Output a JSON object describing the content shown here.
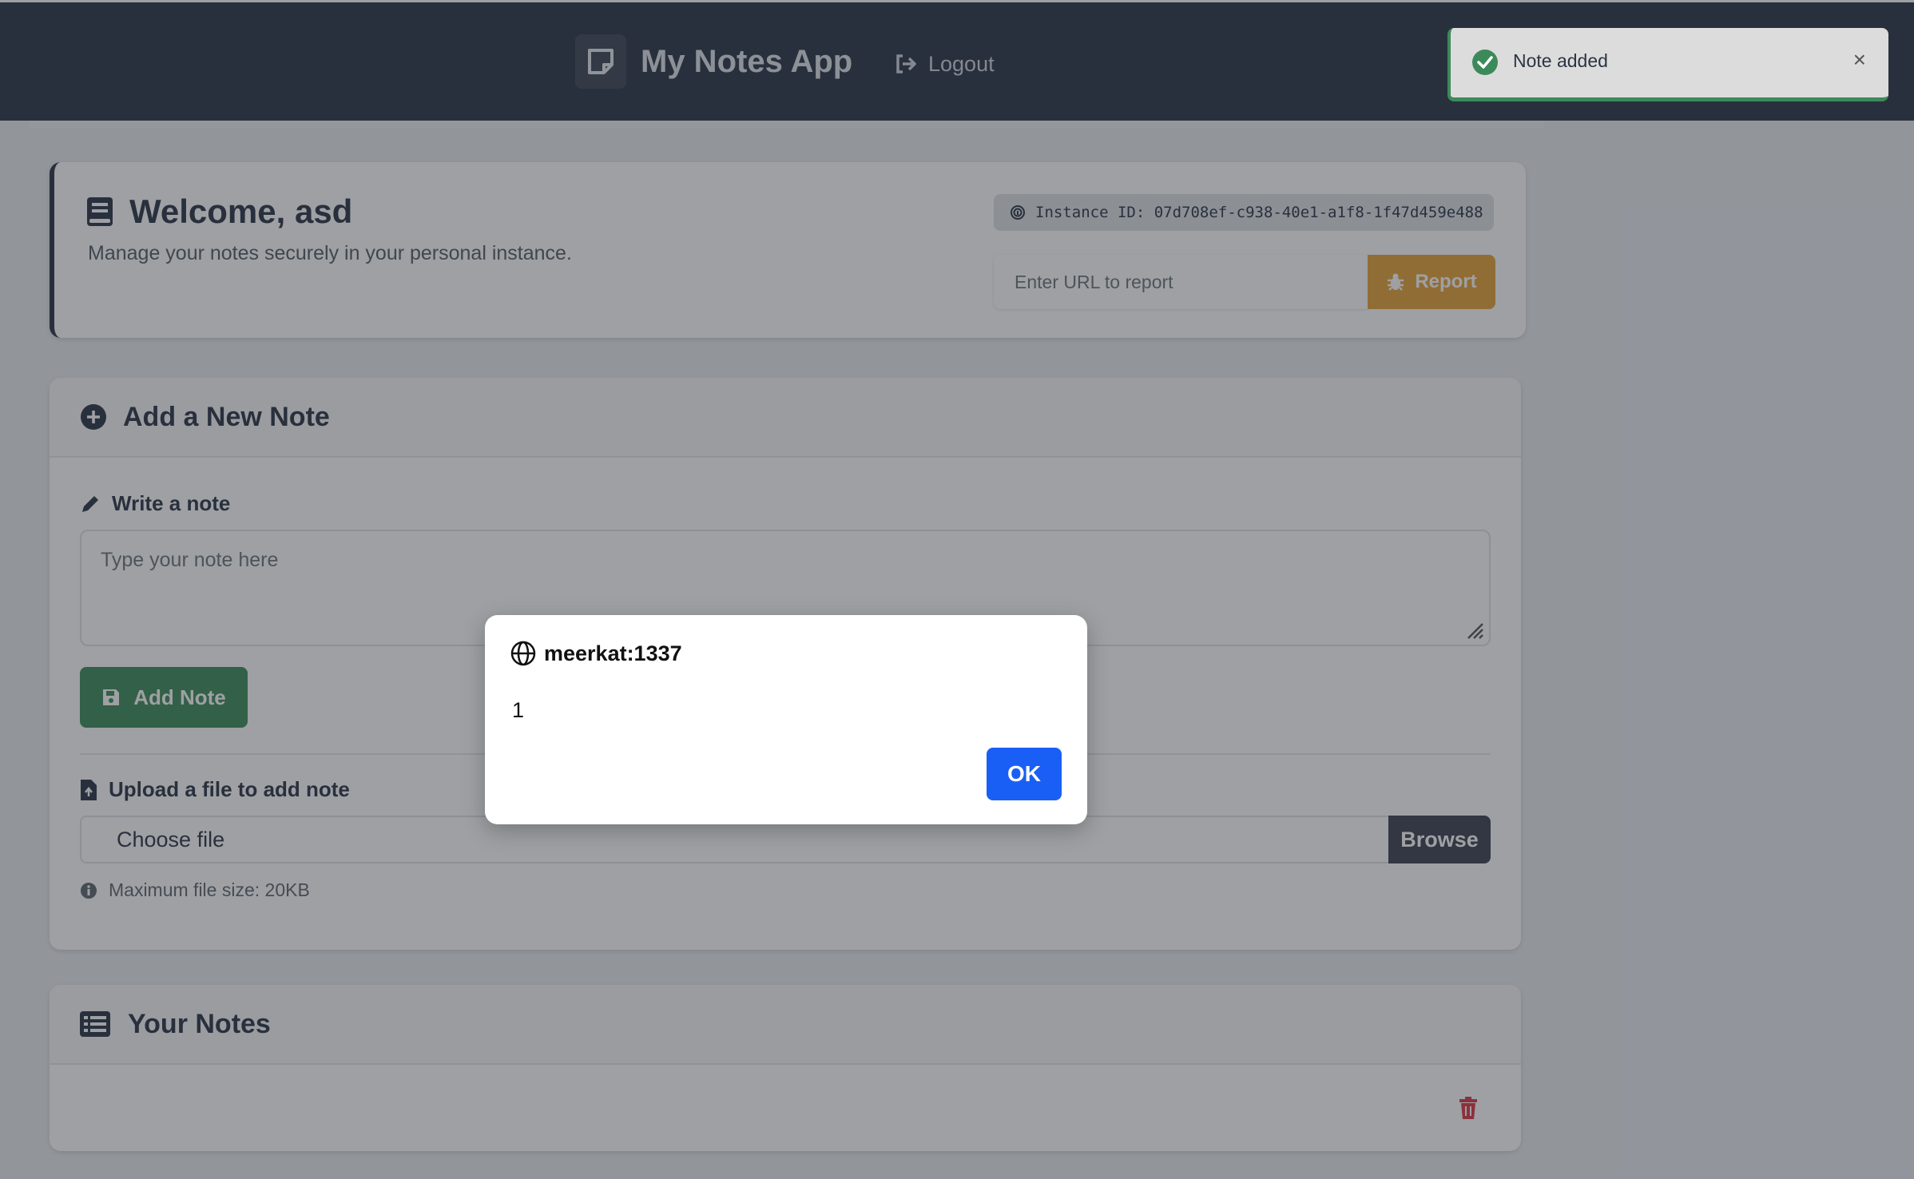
{
  "navbar": {
    "brand": "My Notes App",
    "logout_label": "Logout"
  },
  "welcome": {
    "title": "Welcome, asd",
    "subtitle": "Manage your notes securely in your personal instance.",
    "instance_id": "Instance ID: 07d708ef-c938-40e1-a1f8-1f47d459e488",
    "report_placeholder": "Enter URL to report",
    "report_label": "Report"
  },
  "add_note": {
    "title": "Add a New Note",
    "write_label": "Write a note",
    "textarea_placeholder": "Type your note here",
    "add_button_label": "Add Note",
    "upload_label": "Upload a file to add note",
    "choose_file_label": "Choose file",
    "browse_label": "Browse",
    "file_hint": "Maximum file size: 20KB"
  },
  "notes": {
    "title": "Your Notes"
  },
  "toast": {
    "message": "Note added",
    "close_symbol": "×"
  },
  "dialog": {
    "origin": "meerkat:1337",
    "message": "1",
    "ok_label": "OK"
  },
  "colors": {
    "navbar": "#2b3445",
    "accent_green": "#3c8a5a",
    "report_orange": "#e8a33a",
    "dialog_blue": "#1a5ff5",
    "danger_red": "#dc3545"
  },
  "icons": {
    "brand": "sticky-note-icon",
    "logout": "sign-out-icon",
    "welcome": "book-icon",
    "instance": "fingerprint-icon",
    "report": "bug-icon",
    "add_note": "plus-circle-icon",
    "write": "pencil-icon",
    "save": "save-icon",
    "upload": "file-upload-icon",
    "info": "info-circle-icon",
    "notes": "list-icon",
    "delete": "trash-icon",
    "toast": "check-circle-icon",
    "dialog_origin": "globe-icon"
  }
}
